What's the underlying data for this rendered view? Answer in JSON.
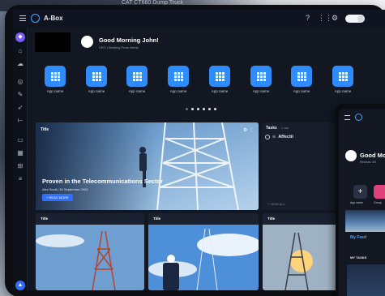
{
  "background": {
    "top_text": "CAT CT660 Dump Truck"
  },
  "app": {
    "title": "A-Box"
  },
  "header": {
    "greeting": "Good Morning John!",
    "role": "CEO | Working From Home"
  },
  "apps": [
    {
      "label": "App name"
    },
    {
      "label": "App name"
    },
    {
      "label": "App name"
    },
    {
      "label": "App name"
    },
    {
      "label": "App name"
    },
    {
      "label": "App name"
    },
    {
      "label": "App name"
    },
    {
      "label": "App name"
    }
  ],
  "hero": {
    "card_title": "Title",
    "headline": "Proven in the Telecommunications Sector",
    "meta": "Alex Scott | 30 September 2024",
    "button": "+ READ MORE"
  },
  "tasks": {
    "title": "Tasks",
    "count": "1 new",
    "items": [
      {
        "label": "Affectii"
      }
    ],
    "view_all": "+ VIEW ALL"
  },
  "cards": [
    {
      "title": "Title"
    },
    {
      "title": "Title"
    },
    {
      "title": "Title"
    }
  ],
  "phone": {
    "greeting": "Good Mo",
    "role": "Reviews: 3/5",
    "add_label": "App name",
    "group_label": "Group",
    "feed": "My Feed",
    "tasks": "MY TASKS"
  },
  "colors": {
    "accent": "#2f8cff",
    "background": "#121722",
    "sidebar_active": "#7b5cff"
  },
  "icons": {
    "topbar": [
      "help-icon",
      "apps-grid-icon",
      "settings-icon",
      "theme-toggle"
    ],
    "sidebar": [
      "home-icon",
      "chat-icon",
      "check-icon",
      "tool-icon",
      "rocket-icon",
      "org-icon",
      "message-icon",
      "calendar-icon",
      "team-icon",
      "document-icon"
    ]
  }
}
